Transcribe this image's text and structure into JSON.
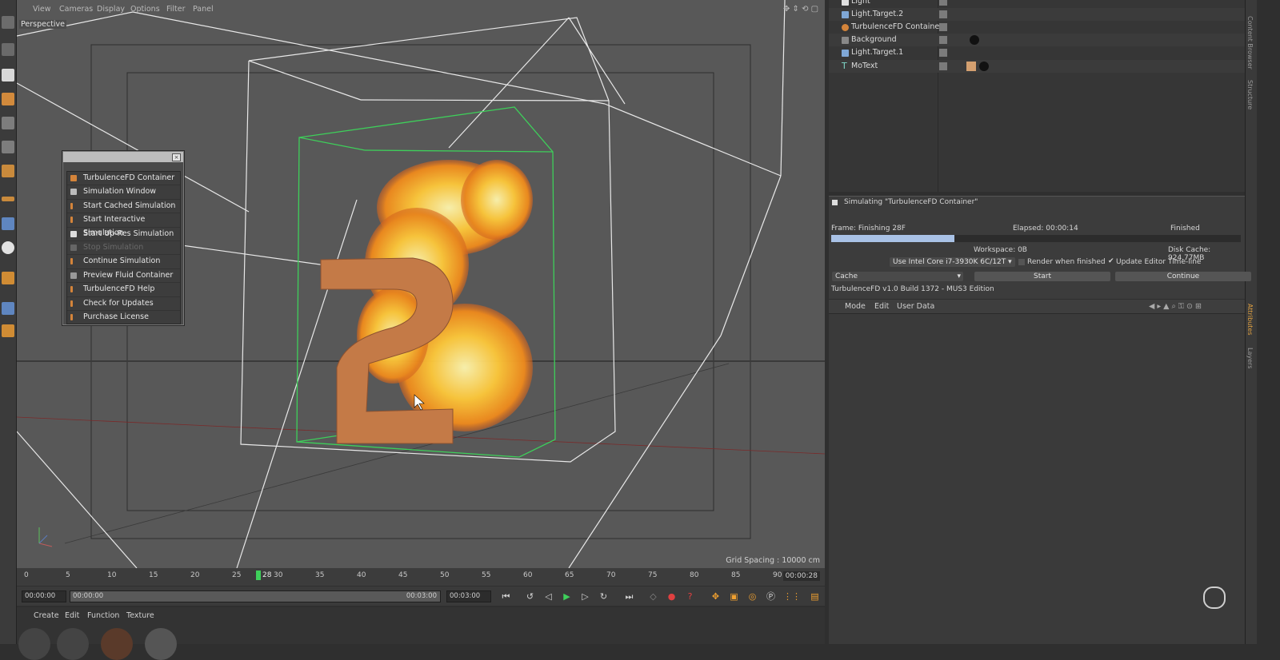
{
  "viewport": {
    "menu": [
      "View",
      "Cameras",
      "Display",
      "Options",
      "Filter",
      "Panel"
    ],
    "view_label": "Perspective",
    "grid_spacing": "Grid Spacing : 10000 cm"
  },
  "tfd_menu": {
    "items": [
      {
        "label": "TurbulenceFD Container",
        "icon": "container-icon",
        "enabled": true
      },
      {
        "label": "Simulation Window",
        "icon": "window-icon",
        "enabled": true
      },
      {
        "label": "Start Cached Simulation",
        "icon": "cached-sim-icon",
        "enabled": true
      },
      {
        "label": "Start Interactive Simulation",
        "icon": "interactive-sim-icon",
        "enabled": true
      },
      {
        "label": "Start Up-Res Simulation",
        "icon": "upres-sim-icon",
        "enabled": true
      },
      {
        "label": "Stop Simulation",
        "icon": "stop-sim-icon",
        "enabled": false
      },
      {
        "label": "Continue Simulation",
        "icon": "continue-sim-icon",
        "enabled": true
      },
      {
        "label": "Preview Fluid Container",
        "icon": "preview-icon",
        "enabled": true
      },
      {
        "label": "TurbulenceFD Help",
        "icon": "help-icon",
        "enabled": true
      },
      {
        "label": "Check for Updates",
        "icon": "updates-icon",
        "enabled": true
      },
      {
        "label": "Purchase License",
        "icon": "license-icon",
        "enabled": true
      }
    ]
  },
  "timeline": {
    "ticks": [
      "0",
      "5",
      "10",
      "15",
      "20",
      "25",
      "30",
      "35",
      "40",
      "45",
      "50",
      "55",
      "60",
      "65",
      "70",
      "75",
      "80",
      "85",
      "90"
    ],
    "current_frame": "28",
    "frame_readout": "00:00:28",
    "start_time": "00:00:00",
    "range_start": "00:00:00",
    "range_end": "00:03:00",
    "end_time": "00:03:00"
  },
  "bottom_menu": [
    "Create",
    "Edit",
    "Function",
    "Texture"
  ],
  "objects": [
    {
      "name": "Light",
      "icon": "light-icon"
    },
    {
      "name": "Light.Target.2",
      "icon": "target-icon"
    },
    {
      "name": "TurbulenceFD Container",
      "icon": "container-icon"
    },
    {
      "name": "Background",
      "icon": "background-icon"
    },
    {
      "name": "Light.Target.1",
      "icon": "target-icon"
    },
    {
      "name": "MoText",
      "icon": "text-icon"
    }
  ],
  "right_tabs": [
    "Content Browser",
    "Structure",
    "Attributes",
    "Layers"
  ],
  "sim": {
    "title": "Simulating \"TurbulenceFD Container\"",
    "frame": "Frame: Finishing 28F",
    "elapsed": "Elapsed: 00:00:14",
    "status": "Finished",
    "progress": 0.3,
    "workspace": "Workspace: 0B",
    "disk_cache": "Disk Cache: 924.77MB",
    "device": "Use  Intel Core i7-3930K 6C/12T",
    "render_when_finished": "Render when finished",
    "update_editor": "Update Editor Time-line",
    "cache_select": "Cache",
    "start": "Start",
    "continue": "Continue",
    "build": "TurbulenceFD v1.0 Build 1372 - MUS3 Edition"
  },
  "attributes": {
    "menu": [
      "Mode",
      "Edit",
      "User Data"
    ]
  },
  "colors": {
    "accent": "#7fa7d6",
    "selection_green": "#3ecf5a",
    "fire_orange": "#f08a1c",
    "object_brown": "#c47a47"
  }
}
